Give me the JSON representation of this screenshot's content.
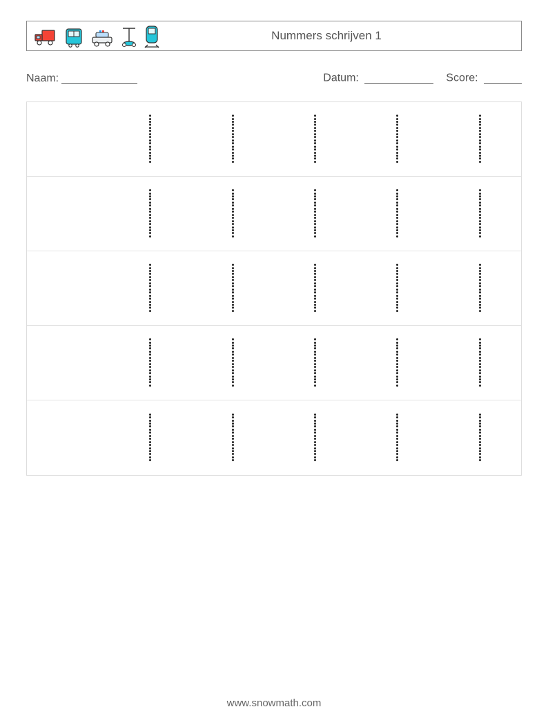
{
  "header": {
    "title": "Nummers schrijven 1",
    "icon_names": [
      "truck-icon",
      "bus-icon",
      "police-car-icon",
      "segway-icon",
      "train-icon"
    ]
  },
  "meta": {
    "name_label": "Naam:",
    "date_label": "Datum:",
    "score_label": "Score:"
  },
  "practice": {
    "rows": 5,
    "cols": 6,
    "glyph": "1"
  },
  "footer": {
    "text": "www.snowmath.com"
  }
}
